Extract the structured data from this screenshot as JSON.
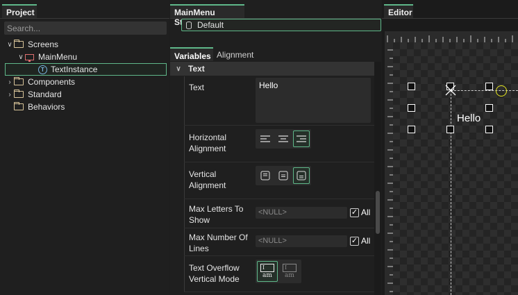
{
  "project": {
    "tab": "Project",
    "search_placeholder": "Search...",
    "tree": [
      {
        "label": "Screens",
        "expanded": true,
        "icon": "folder-icon"
      },
      {
        "label": "MainMenu",
        "expanded": true,
        "icon": "screen-icon"
      },
      {
        "label": "TextInstance",
        "selected": true,
        "icon": "text-instance-icon"
      },
      {
        "label": "Components",
        "expanded": false,
        "icon": "folder-icon"
      },
      {
        "label": "Standard",
        "expanded": false,
        "icon": "folder-icon"
      },
      {
        "label": "Behaviors",
        "icon": "folder-icon"
      }
    ]
  },
  "states": {
    "tab": "MainMenu States",
    "items": [
      "Default"
    ]
  },
  "properties": {
    "tabs": [
      "Variables",
      "Alignment"
    ],
    "category": "Text",
    "rows": {
      "text": {
        "label": "Text",
        "value": "Hello"
      },
      "horizontal_alignment": {
        "label": "Horizontal Alignment",
        "selected": "right"
      },
      "vertical_alignment": {
        "label": "Vertical Alignment",
        "selected": "bottom"
      },
      "max_letters": {
        "label": "Max Letters To Show",
        "value": "<NULL>",
        "all_label": "All",
        "all_checked": true
      },
      "max_lines": {
        "label": "Max Number Of Lines",
        "value": "<NULL>",
        "all_label": "All",
        "all_checked": true
      },
      "overflow": {
        "label": "Text Overflow Vertical Mode",
        "option_label": "am",
        "selected": 0
      }
    }
  },
  "editor": {
    "tab": "Editor",
    "canvas_text": "Hello"
  },
  "colors": {
    "accent": "#5fb88a",
    "origin_marker": "#e6e620"
  }
}
